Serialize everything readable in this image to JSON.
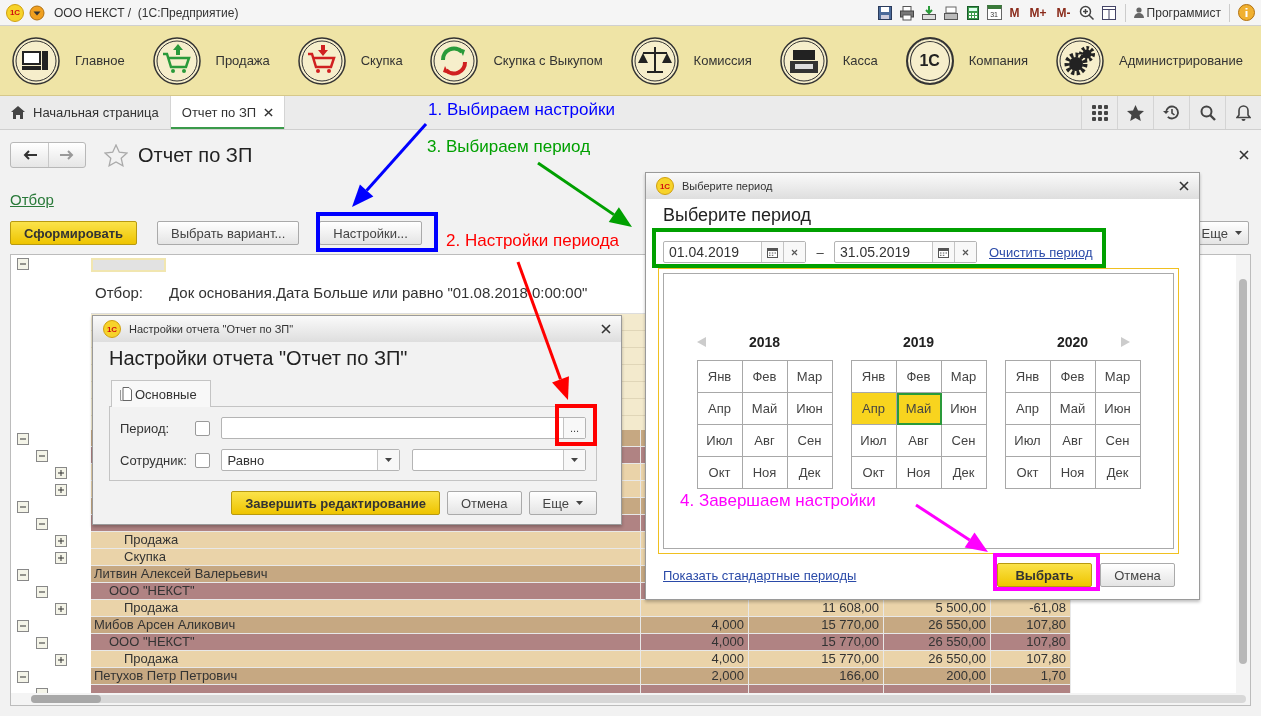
{
  "window": {
    "logo": "1С",
    "title": "ООО НЕКСТ /  (1С:Предприятие)"
  },
  "toolbar": [
    {
      "kind": "save"
    },
    {
      "kind": "print"
    },
    {
      "kind": "export"
    },
    {
      "kind": "scanner"
    },
    {
      "kind": "calculator"
    },
    {
      "kind": "calendar",
      "label": "31"
    },
    {
      "kind": "text",
      "label": "M"
    },
    {
      "kind": "text",
      "label": "M+"
    },
    {
      "kind": "text",
      "label": "M-"
    },
    {
      "kind": "zoom"
    },
    {
      "kind": "panel"
    }
  ],
  "user": "Программист",
  "sections": [
    {
      "label": "Главное",
      "kind": "computer"
    },
    {
      "label": "Продажа",
      "kind": "cart-up"
    },
    {
      "label": "Скупка",
      "kind": "cart-down"
    },
    {
      "label": "Скупка с Выкупом",
      "kind": "cycle"
    },
    {
      "label": "Комиссия",
      "kind": "scales"
    },
    {
      "label": "Касса",
      "kind": "register"
    },
    {
      "label": "Компания",
      "kind": "logo",
      "badge": "1С"
    },
    {
      "label": "Администрирование",
      "kind": "gears"
    }
  ],
  "tabs": [
    {
      "label": "Начальная страница",
      "selected": false,
      "kind": "home"
    },
    {
      "label": "Отчет по ЗП",
      "selected": true,
      "kind": "document"
    }
  ],
  "form": {
    "title": "Отчет по ЗП",
    "filter_link": "Отбор",
    "more": "Еще",
    "buttons": [
      {
        "label": "Сформировать",
        "kind": "primary"
      },
      {
        "label": "Выбрать вариант...",
        "kind": "normal"
      },
      {
        "label": "Настройки...",
        "kind": "normal"
      }
    ]
  },
  "report": {
    "filter": {
      "expanded": true,
      "label": "Отбор:",
      "text": "Док основания.Дата Больше или равно \"01.08.2018 0:00:00\""
    },
    "rows": [
      {
        "expanded": true,
        "children": [
          {
            "expanded": true,
            "children": [
              {
                "expanded": false
              },
              {
                "expanded": false
              }
            ]
          }
        ]
      },
      {
        "expanded": true,
        "children": [
          {
            "expanded": true,
            "children": [
              {
                "expanded": false,
                "label": "Продажа"
              },
              {
                "expanded": false,
                "label": "Скупка"
              }
            ]
          }
        ]
      },
      {
        "expanded": true,
        "label": "Литвин Алексей Валерьевич",
        "children": [
          {
            "expanded": true,
            "label": "ООО \"НЕКСТ\"",
            "children": [
              {
                "expanded": false,
                "label": "Продажа",
                "column_3": "11 608,00",
                "column_4": "5 500,00",
                "column_5": "-61,08"
              }
            ]
          }
        ]
      },
      {
        "expanded": true,
        "label": "Мибов Арсен Аликович",
        "column_2": "4,000",
        "column_3": "15 770,00",
        "column_4": "26 550,00",
        "column_5": "107,80",
        "children": [
          {
            "expanded": true,
            "label": "ООО \"НЕКСТ\"",
            "column_2": "4,000",
            "column_3": "15 770,00",
            "column_4": "26 550,00",
            "column_5": "107,80",
            "children": [
              {
                "expanded": false,
                "label": "Продажа",
                "column_2": "4,000",
                "column_3": "15 770,00",
                "column_4": "26 550,00",
                "column_5": "107,80"
              }
            ]
          }
        ]
      },
      {
        "expanded": true,
        "label": "Петухов Петр Петрович",
        "column_2": "2,000",
        "column_3": "166,00",
        "column_4": "200,00",
        "column_5": "1,70",
        "children": [
          {
            "expanded": true
          }
        ]
      }
    ]
  },
  "settings_dialog": {
    "logo": "1С",
    "title": "Настройки отчета \"Отчет по ЗП\"",
    "heading": "Настройки отчета \"Отчет по ЗП\"",
    "tab": "Основные",
    "fields": [
      {
        "kind": "period",
        "label": "Период:",
        "checked": false,
        "button": "..."
      },
      {
        "kind": "condition",
        "label": "Сотрудник:",
        "checked": false,
        "value": "Равно"
      }
    ],
    "buttons": [
      {
        "label": "Завершить редактирование",
        "kind": "primary"
      },
      {
        "label": "Отмена",
        "kind": "normal"
      },
      {
        "label": "Еще",
        "kind": "menu"
      }
    ]
  },
  "period_dialog": {
    "logo": "1С",
    "title": "Выберите период",
    "heading": "Выберите период",
    "start": "01.04.2019",
    "separator": "–",
    "end": "31.05.2019",
    "clear_link": "Очистить период",
    "years": [
      {
        "year": "2018",
        "months": [
          {
            "label": "Янв",
            "selected": false,
            "focused": false
          },
          {
            "label": "Фев",
            "selected": false,
            "focused": false
          },
          {
            "label": "Мар",
            "selected": false,
            "focused": false
          },
          {
            "label": "Апр",
            "selected": false,
            "focused": false
          },
          {
            "label": "Май",
            "selected": false,
            "focused": false
          },
          {
            "label": "Июн",
            "selected": false,
            "focused": false
          },
          {
            "label": "Июл",
            "selected": false,
            "focused": false
          },
          {
            "label": "Авг",
            "selected": false,
            "focused": false
          },
          {
            "label": "Сен",
            "selected": false,
            "focused": false
          },
          {
            "label": "Окт",
            "selected": false,
            "focused": false
          },
          {
            "label": "Ноя",
            "selected": false,
            "focused": false
          },
          {
            "label": "Дек",
            "selected": false,
            "focused": false
          }
        ]
      },
      {
        "year": "2019",
        "months": [
          {
            "label": "Янв",
            "selected": false,
            "focused": false
          },
          {
            "label": "Фев",
            "selected": false,
            "focused": false
          },
          {
            "label": "Мар",
            "selected": false,
            "focused": false
          },
          {
            "label": "Апр",
            "selected": true,
            "focused": false
          },
          {
            "label": "Май",
            "selected": true,
            "focused": true
          },
          {
            "label": "Июн",
            "selected": false,
            "focused": false
          },
          {
            "label": "Июл",
            "selected": false,
            "focused": false
          },
          {
            "label": "Авг",
            "selected": false,
            "focused": false
          },
          {
            "label": "Сен",
            "selected": false,
            "focused": false
          },
          {
            "label": "Окт",
            "selected": false,
            "focused": false
          },
          {
            "label": "Ноя",
            "selected": false,
            "focused": false
          },
          {
            "label": "Дек",
            "selected": false,
            "focused": false
          }
        ]
      },
      {
        "year": "2020",
        "months": [
          {
            "label": "Янв",
            "selected": false,
            "focused": false
          },
          {
            "label": "Фев",
            "selected": false,
            "focused": false
          },
          {
            "label": "Мар",
            "selected": false,
            "focused": false
          },
          {
            "label": "Апр",
            "selected": false,
            "focused": false
          },
          {
            "label": "Май",
            "selected": false,
            "focused": false
          },
          {
            "label": "Июн",
            "selected": false,
            "focused": false
          },
          {
            "label": "Июл",
            "selected": false,
            "focused": false
          },
          {
            "label": "Авг",
            "selected": false,
            "focused": false
          },
          {
            "label": "Сен",
            "selected": false,
            "focused": false
          },
          {
            "label": "Окт",
            "selected": false,
            "focused": false
          },
          {
            "label": "Ноя",
            "selected": false,
            "focused": false
          },
          {
            "label": "Дек",
            "selected": false,
            "focused": false
          }
        ]
      }
    ],
    "standard_link": "Показать стандартные периоды",
    "buttons": [
      {
        "label": "Выбрать",
        "kind": "primary"
      },
      {
        "label": "Отмена",
        "kind": "normal"
      }
    ]
  },
  "annotations": [
    {
      "text": "1. Выбираем настройки",
      "color": "#0000ff"
    },
    {
      "text": "3. Выбираем период",
      "color": "#00a000"
    },
    {
      "text": "2. Настройки периода",
      "color": "#ff0000"
    },
    {
      "text": "4. Завершаем настройки",
      "color": "#ff00ff"
    }
  ]
}
